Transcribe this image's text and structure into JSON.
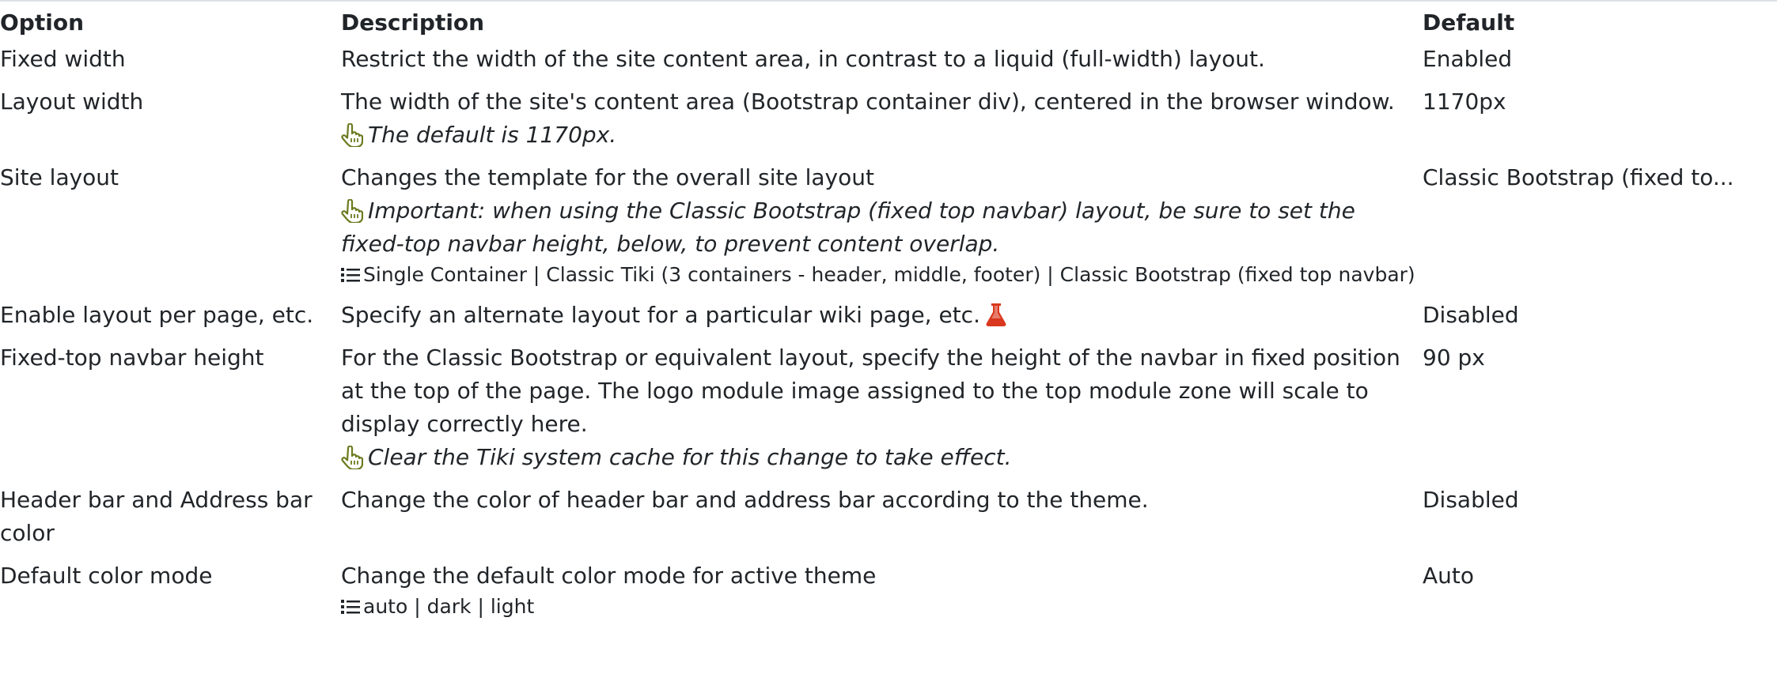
{
  "table": {
    "headers": {
      "option": "Option",
      "description": "Description",
      "default": "Default"
    },
    "rows": [
      {
        "option": "Fixed width",
        "description": "Restrict the width of the site content area, in contrast to a liquid (full-width) layout.",
        "default": "Enabled"
      },
      {
        "option": "Layout width",
        "description": "The width of the site's content area (Bootstrap container div), centered in the browser window.",
        "hint": "The default is 1170px.",
        "default": "1170px"
      },
      {
        "option": "Site layout",
        "description": "Changes the template for the overall site layout",
        "hint": "Important: when using the Classic Bootstrap (fixed top navbar) layout, be sure to set the fixed-top navbar height, below, to prevent content overlap.",
        "options": "Single Container | Classic Tiki (3 containers - header, middle, footer) | Classic Bootstrap (fixed top navbar)",
        "default": "Classic Bootstrap (fixed to..."
      },
      {
        "option": "Enable layout per page, etc.",
        "description": "Specify an alternate layout for a particular wiki page, etc.",
        "icon": "flask-icon",
        "default": "Disabled"
      },
      {
        "option": "Fixed-top navbar height",
        "description": "For the Classic Bootstrap or equivalent layout, specify the height of the navbar in fixed position at the top of the page. The logo module image assigned to the top module zone will scale to display correctly here.",
        "hint": "Clear the Tiki system cache for this change to take effect.",
        "default": "90 px"
      },
      {
        "option": "Header bar and Address bar color",
        "description": "Change the color of header bar and address bar according to the theme.",
        "default": "Disabled"
      },
      {
        "option": "Default color mode",
        "description": "Change the default color mode for active theme",
        "options": "auto | dark | light",
        "default": "Auto"
      }
    ]
  },
  "colors": {
    "hint_icon": "#6b7a1f",
    "flask_icon": "#d9381e",
    "text": "#212529"
  }
}
